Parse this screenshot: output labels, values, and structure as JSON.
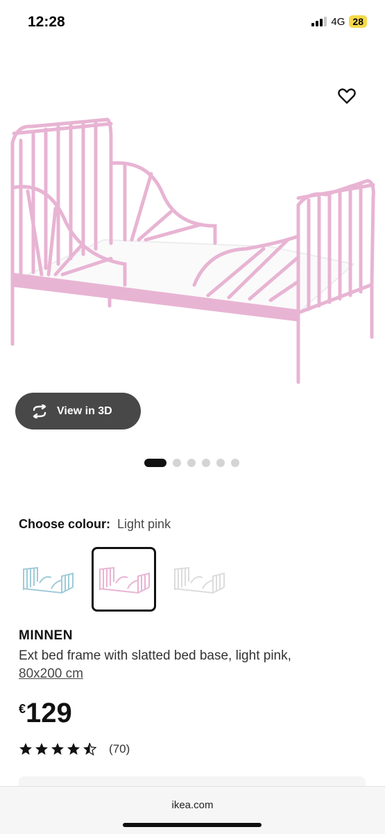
{
  "status_bar": {
    "time": "12:28",
    "network": "4G",
    "battery": "28"
  },
  "product_image": {
    "icon": "bed-frame-image",
    "frame_color": "#e8b4d3"
  },
  "view_3d": {
    "label": "View in 3D",
    "icon": "rotate-icon"
  },
  "carousel": {
    "total": 6,
    "active_index": 0
  },
  "colour": {
    "label": "Choose colour:",
    "value": "Light pink",
    "swatches": [
      {
        "name": "Light blue",
        "color": "#9fcbd8",
        "selected": false
      },
      {
        "name": "Light pink",
        "color": "#e8b4d3",
        "selected": true
      },
      {
        "name": "White",
        "color": "#ececec",
        "selected": false
      }
    ]
  },
  "product": {
    "name": "MINNEN",
    "description": "Ext bed frame with slatted bed base, light pink,",
    "size": "80x200 cm",
    "currency": "€",
    "price": "129",
    "rating": 4.5,
    "review_count": "(70)"
  },
  "browser": {
    "url": "ikea.com"
  }
}
